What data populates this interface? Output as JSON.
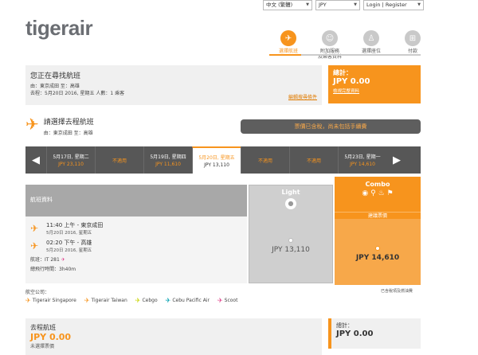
{
  "topbar": {
    "language": "中文 (繁體)",
    "currency": "JPY",
    "account": "Login | Register"
  },
  "logo": "tigerair",
  "steps": [
    {
      "label": "選擇航班",
      "active": true
    },
    {
      "label": "附加服務\n及乘客資料",
      "active": false
    },
    {
      "label": "選擇座位",
      "active": false
    },
    {
      "label": "付款",
      "active": false
    }
  ],
  "summary": {
    "heading": "您正在尋找航班",
    "route": "由：東京成田   至：高雄",
    "trip": "去程：5月20日 2016, 星期五    人數：1 乘客",
    "edit": "編輯搜尋條件"
  },
  "total": {
    "label": "總計：",
    "amount": "JPY 0.00",
    "link": "檢視完整資料"
  },
  "section": {
    "title": "請選擇去程航班",
    "route": "由：東京成田 至：高雄"
  },
  "notice": "票價已含稅，尚未包括手續費",
  "dates": [
    {
      "date": "5月17日, 星期二",
      "price": "JPY 23,110",
      "state": "normal"
    },
    {
      "date": "不適用",
      "price": "",
      "state": "na"
    },
    {
      "date": "5月19日, 星期四",
      "price": "JPY 11,610",
      "state": "normal"
    },
    {
      "date": "5月20日, 星期五",
      "price": "JPY 13,110",
      "state": "current"
    },
    {
      "date": "不適用",
      "price": "",
      "state": "na"
    },
    {
      "date": "不適用",
      "price": "",
      "state": "na"
    },
    {
      "date": "5月23日, 星期一",
      "price": "JPY 14,610",
      "state": "normal"
    }
  ],
  "flight": {
    "header": "航班資料",
    "depart_time": "11:40 上午 - 東京成田",
    "depart_date": "5月20日 2016, 星期五",
    "arrive_time": "02:20 下午 - 高雄",
    "arrive_date": "5月20日 2016, 星期五",
    "flight_label": "航班：",
    "flight_no": "IT 281",
    "duration_label": "總飛行時間：",
    "duration": "3h40m"
  },
  "fares": {
    "light_name": "Light",
    "light_price": "JPY 13,110",
    "combo_name": "Combo",
    "combo_recommend": "建議票價",
    "combo_price": "JPY 14,610",
    "included_note": "已含稅項及燃油費"
  },
  "airlines_label": "航空公司：",
  "airlines": [
    {
      "name": "Tigerair Singapore",
      "color": "#f7941d"
    },
    {
      "name": "Tigerair Taiwan",
      "color": "#f7941d"
    },
    {
      "name": "Cebgo",
      "color": "#c8d400"
    },
    {
      "name": "Cebu Pacific Air",
      "color": "#00a0b0"
    },
    {
      "name": "Scoot",
      "color": "#e0408a"
    }
  ],
  "bottom": {
    "label": "去程航班",
    "amount": "JPY 0.00",
    "note": "未選擇票價"
  },
  "bottom_total": {
    "label": "總計：",
    "amount": "JPY 0.00"
  }
}
